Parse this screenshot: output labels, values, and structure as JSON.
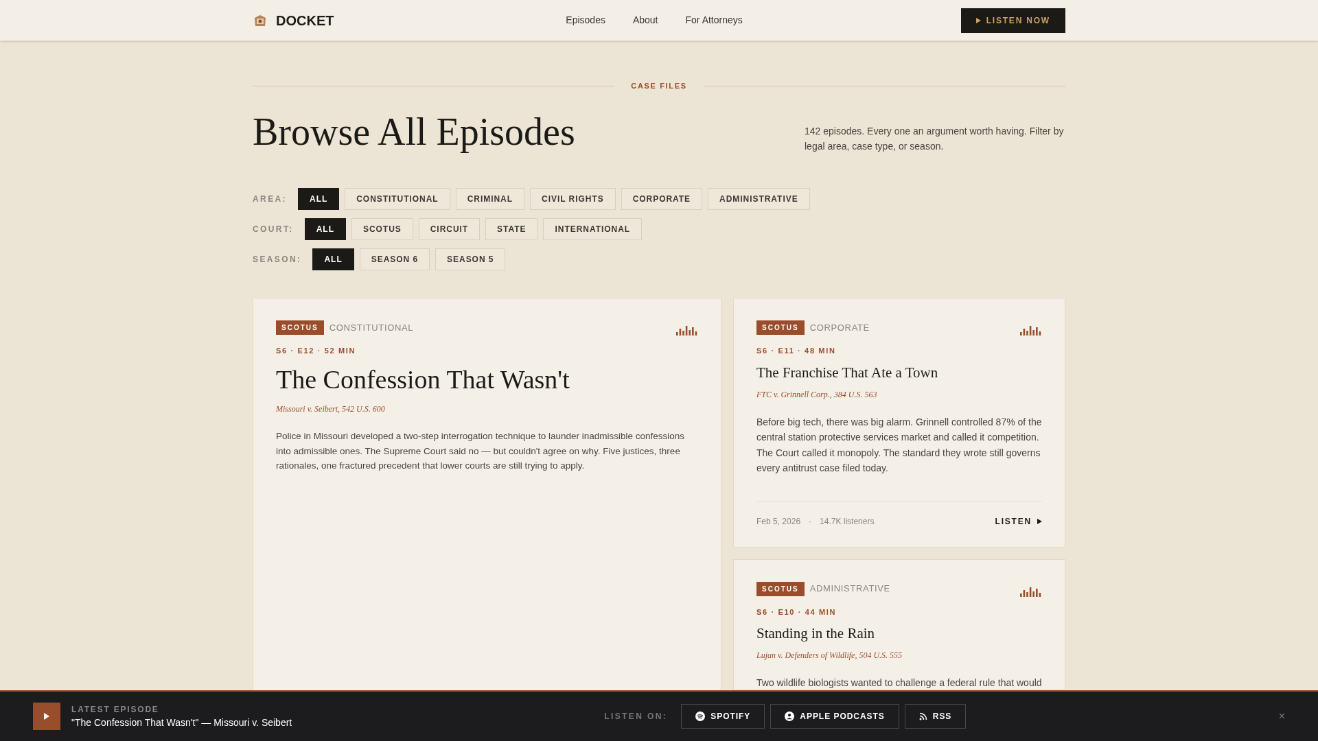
{
  "header": {
    "brand": "DOCKET",
    "nav": [
      {
        "label": "Episodes"
      },
      {
        "label": "About"
      },
      {
        "label": "For Attorneys"
      }
    ],
    "cta": "LISTEN NOW"
  },
  "eyebrow": "CASE FILES",
  "title": "Browse All Episodes",
  "intro": "142 episodes. Every one an argument worth having. Filter by legal area, case type, or season.",
  "filters": [
    {
      "label": "AREA:",
      "options": [
        {
          "label": "ALL",
          "selected": true
        },
        {
          "label": "CONSTITUTIONAL",
          "selected": false
        },
        {
          "label": "CRIMINAL",
          "selected": false
        },
        {
          "label": "CIVIL RIGHTS",
          "selected": false
        },
        {
          "label": "CORPORATE",
          "selected": false
        },
        {
          "label": "ADMINISTRATIVE",
          "selected": false
        }
      ]
    },
    {
      "label": "COURT:",
      "options": [
        {
          "label": "ALL",
          "selected": true
        },
        {
          "label": "SCOTUS",
          "selected": false
        },
        {
          "label": "CIRCUIT",
          "selected": false
        },
        {
          "label": "STATE",
          "selected": false
        },
        {
          "label": "INTERNATIONAL",
          "selected": false
        }
      ]
    },
    {
      "label": "SEASON:",
      "options": [
        {
          "label": "ALL",
          "selected": true
        },
        {
          "label": "SEASON 6",
          "selected": false
        },
        {
          "label": "SEASON 5",
          "selected": false
        }
      ]
    }
  ],
  "episodes": [
    {
      "kind": "featured",
      "court": "SCOTUS",
      "area": "CONSTITUTIONAL",
      "meta": "S6 · E12 · 52 MIN",
      "title": "The Confession That Wasn't",
      "citation": "Missouri v. Seibert, 542 U.S. 600",
      "summary": "Police in Missouri developed a two-step interrogation technique to launder inadmissible confessions into admissible ones. The Supreme Court said no — but couldn't agree on why. Five justices, three rationales, one fractured precedent that lower courts are still trying to apply."
    },
    {
      "kind": "standard",
      "court": "SCOTUS",
      "area": "CORPORATE",
      "meta": "S6 · E11 · 48 MIN",
      "title": "The Franchise That Ate a Town",
      "citation": "FTC v. Grinnell Corp., 384 U.S. 563",
      "summary": "Before big tech, there was big alarm. Grinnell controlled 87% of the central station protective services market and called it competition. The Court called it monopoly. The standard they wrote still governs every antitrust case filed today.",
      "date": "Feb 5, 2026",
      "separator": "·",
      "listeners": "14.7K listeners",
      "action": "LISTEN"
    },
    {
      "kind": "standard",
      "court": "SCOTUS",
      "area": "ADMINISTRATIVE",
      "meta": "S6 · E10 · 44 MIN",
      "title": "Standing in the Rain",
      "citation": "Lujan v. Defenders of Wildlife, 504 U.S. 555",
      "summary": "Two wildlife biologists wanted to challenge a federal rule that would"
    }
  ],
  "player": {
    "label": "LATEST EPISODE",
    "now": "\"The Confession That Wasn't\" — Missouri v. Seibert",
    "listen_on": "LISTEN ON:",
    "platforms": [
      {
        "kind": "spotify",
        "label": "SPOTIFY"
      },
      {
        "kind": "apple",
        "label": "APPLE PODCASTS"
      },
      {
        "kind": "rss",
        "label": "RSS"
      }
    ],
    "close": "×"
  }
}
